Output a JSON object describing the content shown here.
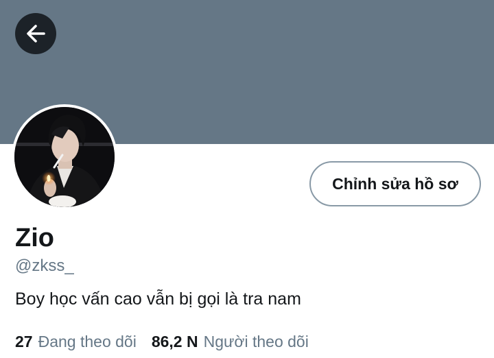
{
  "header": {
    "back_icon": "arrow-left-icon",
    "banner_color": "#657786"
  },
  "profile": {
    "avatar_icon": "profile-photo",
    "edit_button_label": "Chỉnh sửa hồ sơ",
    "display_name": "Zio",
    "handle": "@zkss_",
    "bio": "Boy học vấn cao vẫn bị gọi là tra nam"
  },
  "stats": {
    "following_count": "27",
    "following_label": "Đang theo dõi",
    "followers_count": "86,2 N",
    "followers_label": "Người theo dõi"
  },
  "colors": {
    "text_primary": "#14171a",
    "text_secondary": "#657786",
    "button_border": "#8899a6"
  }
}
